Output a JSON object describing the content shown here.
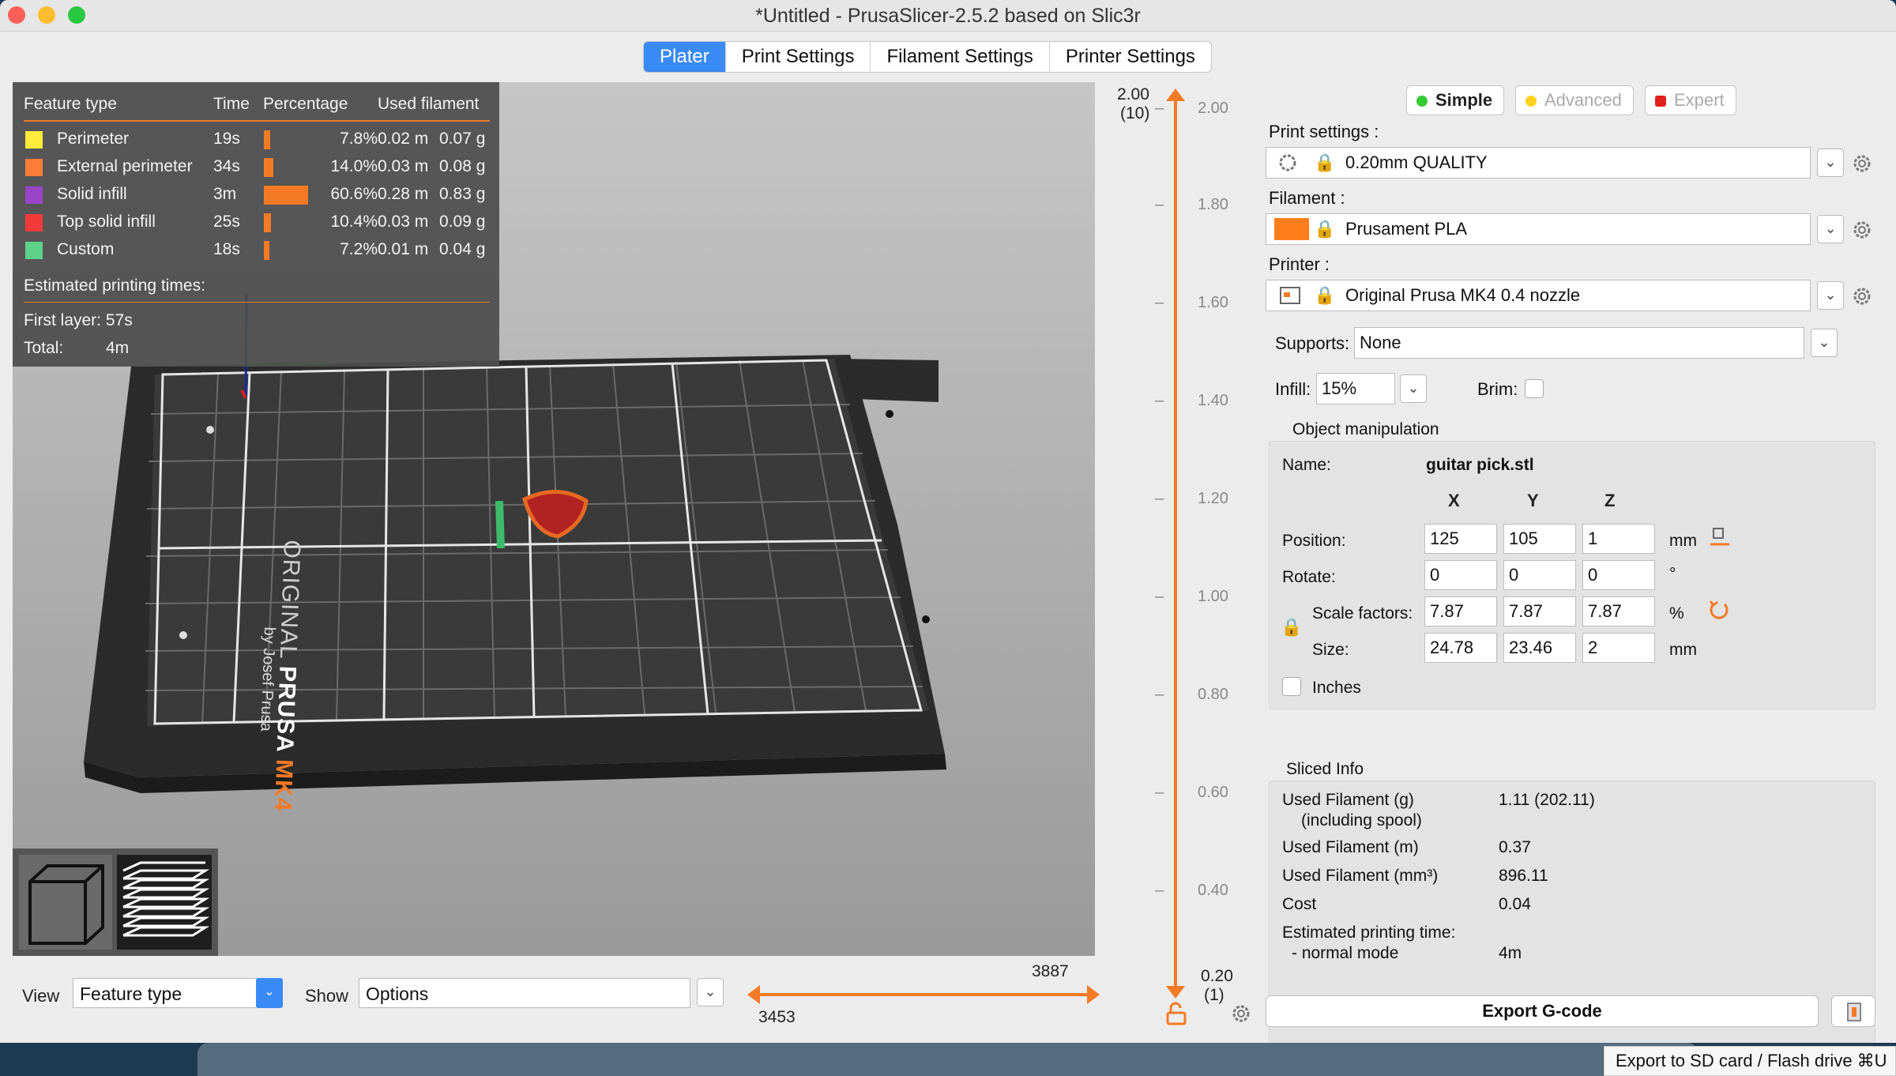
{
  "window": {
    "title": "*Untitled - PrusaSlicer-2.5.2 based on Slic3r"
  },
  "tabs": [
    {
      "label": "Plater",
      "active": true
    },
    {
      "label": "Print Settings",
      "active": false
    },
    {
      "label": "Filament Settings",
      "active": false
    },
    {
      "label": "Printer Settings",
      "active": false
    }
  ],
  "legend": {
    "headers": {
      "feature": "Feature type",
      "time": "Time",
      "percentage": "Percentage",
      "used": "Used filament"
    },
    "rows": [
      {
        "name": "Perimeter",
        "time": "19s",
        "pct": "7.8%",
        "m": "0.02 m",
        "g": "0.07 g",
        "color": "#ffeb3b",
        "fraction": 0.078
      },
      {
        "name": "External perimeter",
        "time": "34s",
        "pct": "14.0%",
        "m": "0.03 m",
        "g": "0.08 g",
        "color": "#ff7d38",
        "fraction": 0.14
      },
      {
        "name": "Solid infill",
        "time": "3m",
        "pct": "60.6%",
        "m": "0.28 m",
        "g": "0.83 g",
        "color": "#9a44c8",
        "fraction": 0.606
      },
      {
        "name": "Top solid infill",
        "time": "25s",
        "pct": "10.4%",
        "m": "0.03 m",
        "g": "0.09 g",
        "color": "#f23a3a",
        "fraction": 0.104
      },
      {
        "name": "Custom",
        "time": "18s",
        "pct": "7.2%",
        "m": "0.01 m",
        "g": "0.04 g",
        "color": "#5ed18a",
        "fraction": 0.072
      }
    ],
    "estimated_label": "Estimated printing times:",
    "first_layer": "First layer: 57s",
    "total_label": "Total:",
    "total_value": "4m"
  },
  "bed": {
    "brand_line1": "ORIGINAL ",
    "brand_prusa": "PRUSA",
    "brand_mk4": " MK4",
    "brand_by": "by Josef Prusa"
  },
  "bottom": {
    "view_label": "View",
    "view_value": "Feature type",
    "show_label": "Show",
    "show_value": "Options",
    "hslider_right": "3887",
    "hslider_left": "3453"
  },
  "vslider": {
    "top_value": "2.00",
    "top_layer": "(10)",
    "bottom_value": "0.20",
    "bottom_layer": "(1)",
    "ticks": [
      "2.00",
      "1.80",
      "1.60",
      "1.40",
      "1.20",
      "1.00",
      "0.80",
      "0.60",
      "0.40"
    ]
  },
  "modes": {
    "simple": "Simple",
    "advanced": "Advanced",
    "expert": "Expert"
  },
  "settings": {
    "print_label": "Print settings :",
    "print_value": "0.20mm QUALITY",
    "filament_label": "Filament :",
    "filament_value": "Prusament PLA",
    "filament_color": "#ff7d1a",
    "printer_label": "Printer :",
    "printer_value": "Original Prusa MK4 0.4 nozzle",
    "supports_label": "Supports:",
    "supports_value": "None",
    "infill_label": "Infill:",
    "infill_value": "15%",
    "brim_label": "Brim:"
  },
  "object": {
    "group_title": "Object manipulation",
    "name_label": "Name:",
    "name_value": "guitar pick.stl",
    "axes": [
      "X",
      "Y",
      "Z"
    ],
    "position_label": "Position:",
    "position": [
      "125",
      "105",
      "1"
    ],
    "position_unit": "mm",
    "rotate_label": "Rotate:",
    "rotate": [
      "0",
      "0",
      "0"
    ],
    "rotate_unit": "°",
    "scale_label": "Scale factors:",
    "scale": [
      "7.87",
      "7.87",
      "7.87"
    ],
    "scale_unit": "%",
    "size_label": "Size:",
    "size": [
      "24.78",
      "23.46",
      "2"
    ],
    "size_unit": "mm",
    "inches_label": "Inches"
  },
  "sliced": {
    "title": "Sliced Info",
    "used_g_label": "Used Filament (g)",
    "used_g_sub": "(including spool)",
    "used_g_value": "1.11 (202.11)",
    "used_m_label": "Used Filament (m)",
    "used_m_value": "0.37",
    "used_mm3_label": "Used Filament (mm³)",
    "used_mm3_value": "896.11",
    "cost_label": "Cost",
    "cost_value": "0.04",
    "est_label": "Estimated printing time:",
    "mode_label": "- normal mode",
    "mode_value": "4m"
  },
  "export": {
    "label": "Export G-code"
  },
  "tooltip": {
    "text": "Export to SD card / Flash drive ⌘U"
  }
}
